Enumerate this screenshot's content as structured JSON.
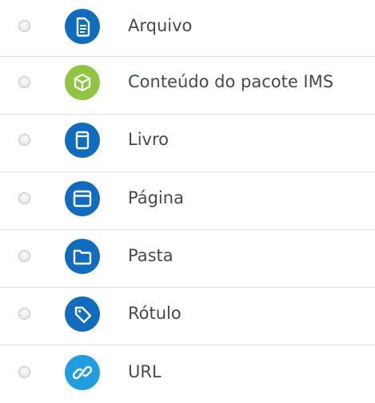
{
  "activities": [
    {
      "label": "Arquivo",
      "icon": "file-icon",
      "color": "#0f6cbf"
    },
    {
      "label": "Conteúdo do pacote IMS",
      "icon": "ims-package-icon",
      "color": "#8ec63f"
    },
    {
      "label": "Livro",
      "icon": "book-icon",
      "color": "#0f6cbf"
    },
    {
      "label": "Página",
      "icon": "page-icon",
      "color": "#0f6cbf"
    },
    {
      "label": "Pasta",
      "icon": "folder-icon",
      "color": "#0f6cbf"
    },
    {
      "label": "Rótulo",
      "icon": "tag-icon",
      "color": "#0f6cbf"
    },
    {
      "label": "URL",
      "icon": "link-icon",
      "color": "#1f9de0"
    }
  ]
}
